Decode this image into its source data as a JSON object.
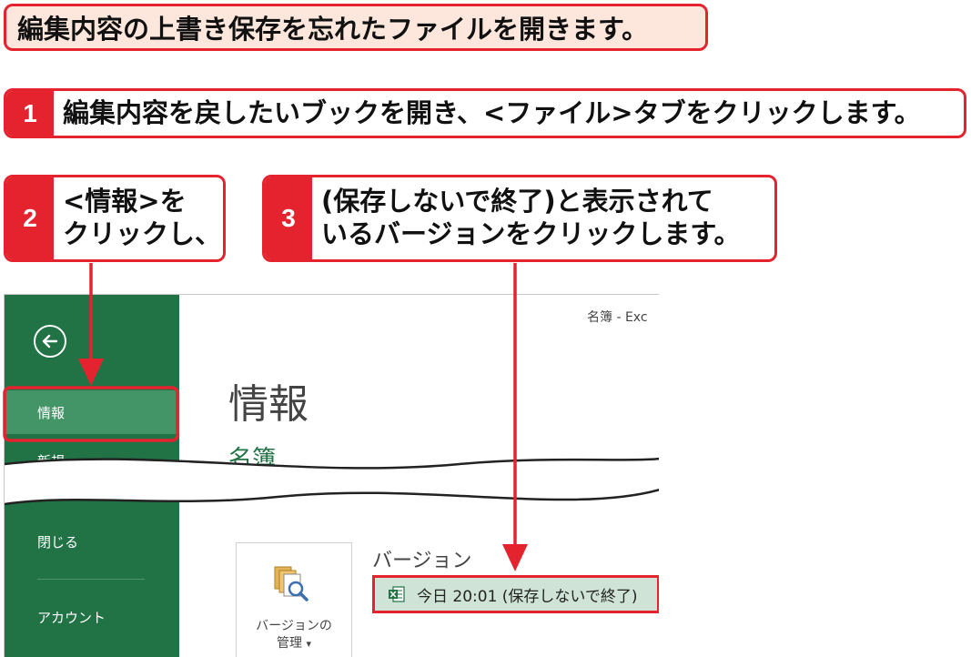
{
  "title_callout": "編集内容の上書き保存を忘れたファイルを開きます。",
  "steps": [
    {
      "number": "1",
      "lines": [
        "編集内容を戻したいブックを開き、<ファイル>タブをクリックします。"
      ]
    },
    {
      "number": "2",
      "lines": [
        "<情報>を",
        "クリックし、"
      ]
    },
    {
      "number": "3",
      "lines": [
        "(保存しないで終了)と表示されて",
        "いるバージョンをクリックします。"
      ]
    }
  ],
  "excel": {
    "window_title": "名簿 - Exc",
    "sidebar": {
      "back_icon": "back-arrow-icon",
      "items": [
        {
          "label": "情報",
          "selected": true
        },
        {
          "label": "新規",
          "selected": false
        },
        {
          "label": "閉じる",
          "selected": false
        },
        {
          "label": "アカウント",
          "selected": false
        }
      ],
      "background": "#217346",
      "selected_background": "#439467"
    },
    "page_title": "情報",
    "workbook_name": "名簿",
    "version_manage": {
      "line1": "バージョンの",
      "line2": "管理",
      "dropdown_glyph": "▾",
      "icon": "version-history-icon"
    },
    "versions_heading": "バージョン",
    "version_entry": {
      "text": "今日 20:01 (保存しないで終了)",
      "icon": "excel-file-icon"
    }
  },
  "accent_color": "#e5232f"
}
